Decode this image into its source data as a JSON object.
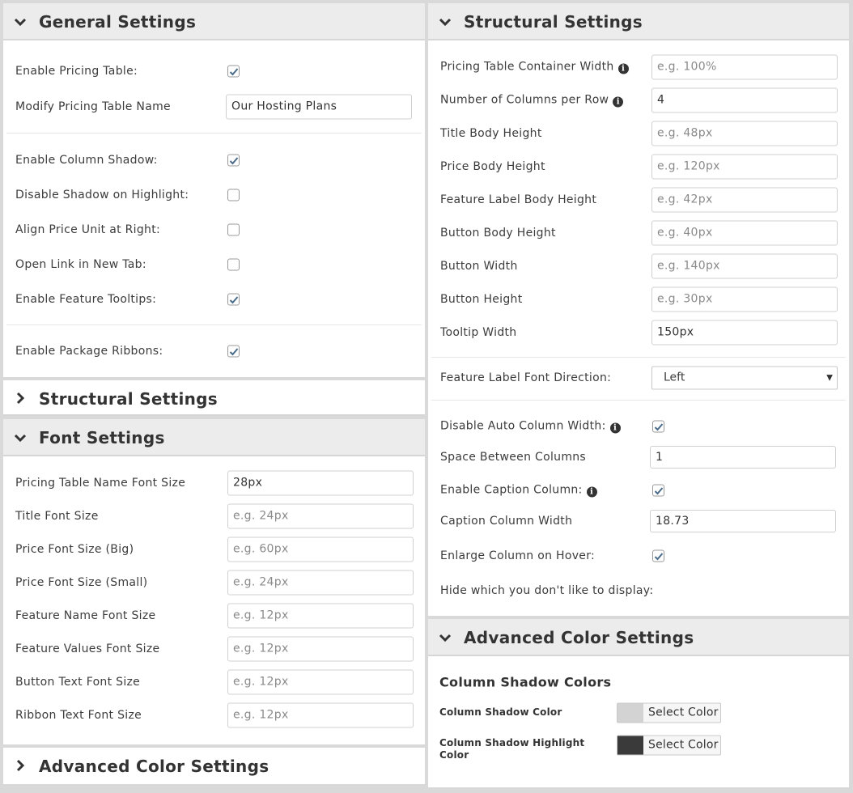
{
  "general": {
    "title": "General Settings",
    "enable_pricing_table": {
      "label": "Enable Pricing Table:",
      "checked": true
    },
    "modify_name": {
      "label": "Modify Pricing Table Name",
      "value": "Our Hosting Plans"
    },
    "enable_column_shadow": {
      "label": "Enable Column Shadow:",
      "checked": true
    },
    "disable_shadow_highlight": {
      "label": "Disable Shadow on Highlight:",
      "checked": false
    },
    "align_price_unit": {
      "label": "Align Price Unit at Right:",
      "checked": false
    },
    "open_link_new_tab": {
      "label": "Open Link in New Tab:",
      "checked": false
    },
    "enable_feature_tooltips": {
      "label": "Enable Feature Tooltips:",
      "checked": true
    },
    "enable_package_ribbons": {
      "label": "Enable Package Ribbons:",
      "checked": true
    }
  },
  "structural_collapsed": {
    "title": "Structural Settings"
  },
  "font": {
    "title": "Font Settings",
    "fields": [
      {
        "label": "Pricing Table Name Font Size",
        "value": "28px",
        "placeholder": ""
      },
      {
        "label": "Title Font Size",
        "value": "",
        "placeholder": "e.g. 24px"
      },
      {
        "label": "Price Font Size (Big)",
        "value": "",
        "placeholder": "e.g. 60px"
      },
      {
        "label": "Price Font Size (Small)",
        "value": "",
        "placeholder": "e.g. 24px"
      },
      {
        "label": "Feature Name Font Size",
        "value": "",
        "placeholder": "e.g. 12px"
      },
      {
        "label": "Feature Values Font Size",
        "value": "",
        "placeholder": "e.g. 12px"
      },
      {
        "label": "Button Text Font Size",
        "value": "",
        "placeholder": "e.g. 12px"
      },
      {
        "label": "Ribbon Text Font Size",
        "value": "",
        "placeholder": "e.g. 12px"
      }
    ]
  },
  "advanced_collapsed": {
    "title": "Advanced Color Settings"
  },
  "structural": {
    "title": "Structural Settings",
    "fields": [
      {
        "label": "Pricing Table Container Width",
        "info": true,
        "value": "",
        "placeholder": "e.g. 100%"
      },
      {
        "label": "Number of Columns per Row",
        "info": true,
        "value": "4",
        "placeholder": ""
      },
      {
        "label": "Title Body Height",
        "info": false,
        "value": "",
        "placeholder": "e.g. 48px"
      },
      {
        "label": "Price Body Height",
        "info": false,
        "value": "",
        "placeholder": "e.g. 120px"
      },
      {
        "label": "Feature Label Body Height",
        "info": false,
        "value": "",
        "placeholder": "e.g. 42px"
      },
      {
        "label": "Button Body Height",
        "info": false,
        "value": "",
        "placeholder": "e.g. 40px"
      },
      {
        "label": "Button Width",
        "info": false,
        "value": "",
        "placeholder": "e.g. 140px"
      },
      {
        "label": "Button Height",
        "info": false,
        "value": "",
        "placeholder": "e.g. 30px"
      },
      {
        "label": "Tooltip Width",
        "info": false,
        "value": "150px",
        "placeholder": ""
      }
    ],
    "font_direction": {
      "label": "Feature Label Font Direction:",
      "selected": "Left"
    },
    "disable_auto_width": {
      "label": "Disable Auto Column Width:",
      "checked": true
    },
    "space_between": {
      "label": "Space Between Columns",
      "value": "1"
    },
    "enable_caption": {
      "label": "Enable Caption Column:",
      "checked": true
    },
    "caption_width": {
      "label": "Caption Column Width",
      "value": "18.73"
    },
    "enlarge_hover": {
      "label": "Enlarge Column on Hover:",
      "checked": true
    },
    "hide_label": "Hide which you don't like to display:"
  },
  "advanced": {
    "title": "Advanced Color Settings",
    "subtitle": "Column Shadow Colors",
    "shadow_color": {
      "label": "Column Shadow Color",
      "button": "Select Color",
      "color": "#d3d3d3"
    },
    "shadow_highlight": {
      "label": "Column Shadow Highlight Color",
      "button": "Select Color",
      "color": "#3a3a3a"
    }
  },
  "info_glyph": "i",
  "colors": {
    "check": "#4a6b8a",
    "header_bg": "#ececec",
    "page_bg": "#d9d9d9"
  }
}
